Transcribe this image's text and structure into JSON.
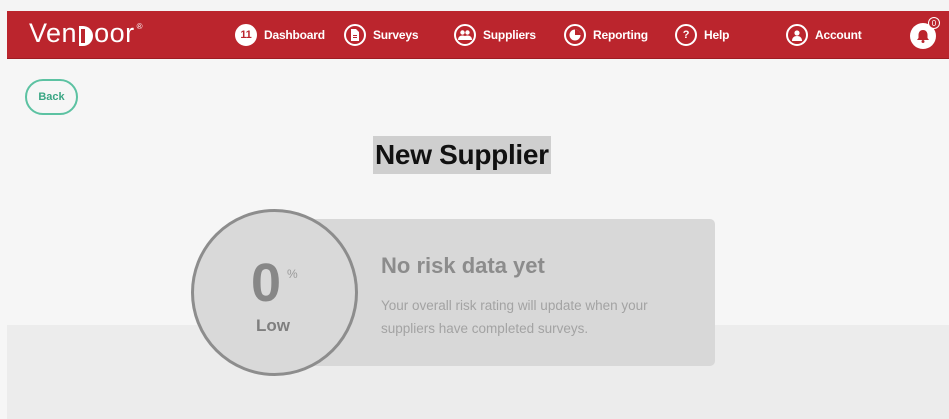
{
  "brand": {
    "name_prefix": "Ven",
    "name_suffix": "oor",
    "reg_mark": "®"
  },
  "nav": {
    "items": [
      {
        "label": "Dashboard",
        "badge": "11",
        "icon": "dashboard-count-icon"
      },
      {
        "label": "Surveys",
        "icon": "survey-document-icon"
      },
      {
        "label": "Suppliers",
        "icon": "suppliers-group-icon"
      },
      {
        "label": "Reporting",
        "icon": "pie-chart-icon"
      },
      {
        "label": "Help",
        "icon": "question-mark-icon",
        "glyph": "?"
      },
      {
        "label": "Account",
        "icon": "account-user-icon"
      }
    ],
    "notifications": {
      "icon": "bell-icon",
      "badge": "0"
    }
  },
  "back_button": {
    "label": "Back"
  },
  "page": {
    "title": "New Supplier"
  },
  "risk": {
    "percent": "0",
    "percent_sign": "%",
    "rating": "Low",
    "heading": "No risk data yet",
    "description": "Your overall risk rating will update when your suppliers have completed surveys."
  },
  "colors": {
    "brand_red": "#bb252d",
    "accent_green": "#5cc2a2",
    "card_grey": "#d8d8d8"
  }
}
